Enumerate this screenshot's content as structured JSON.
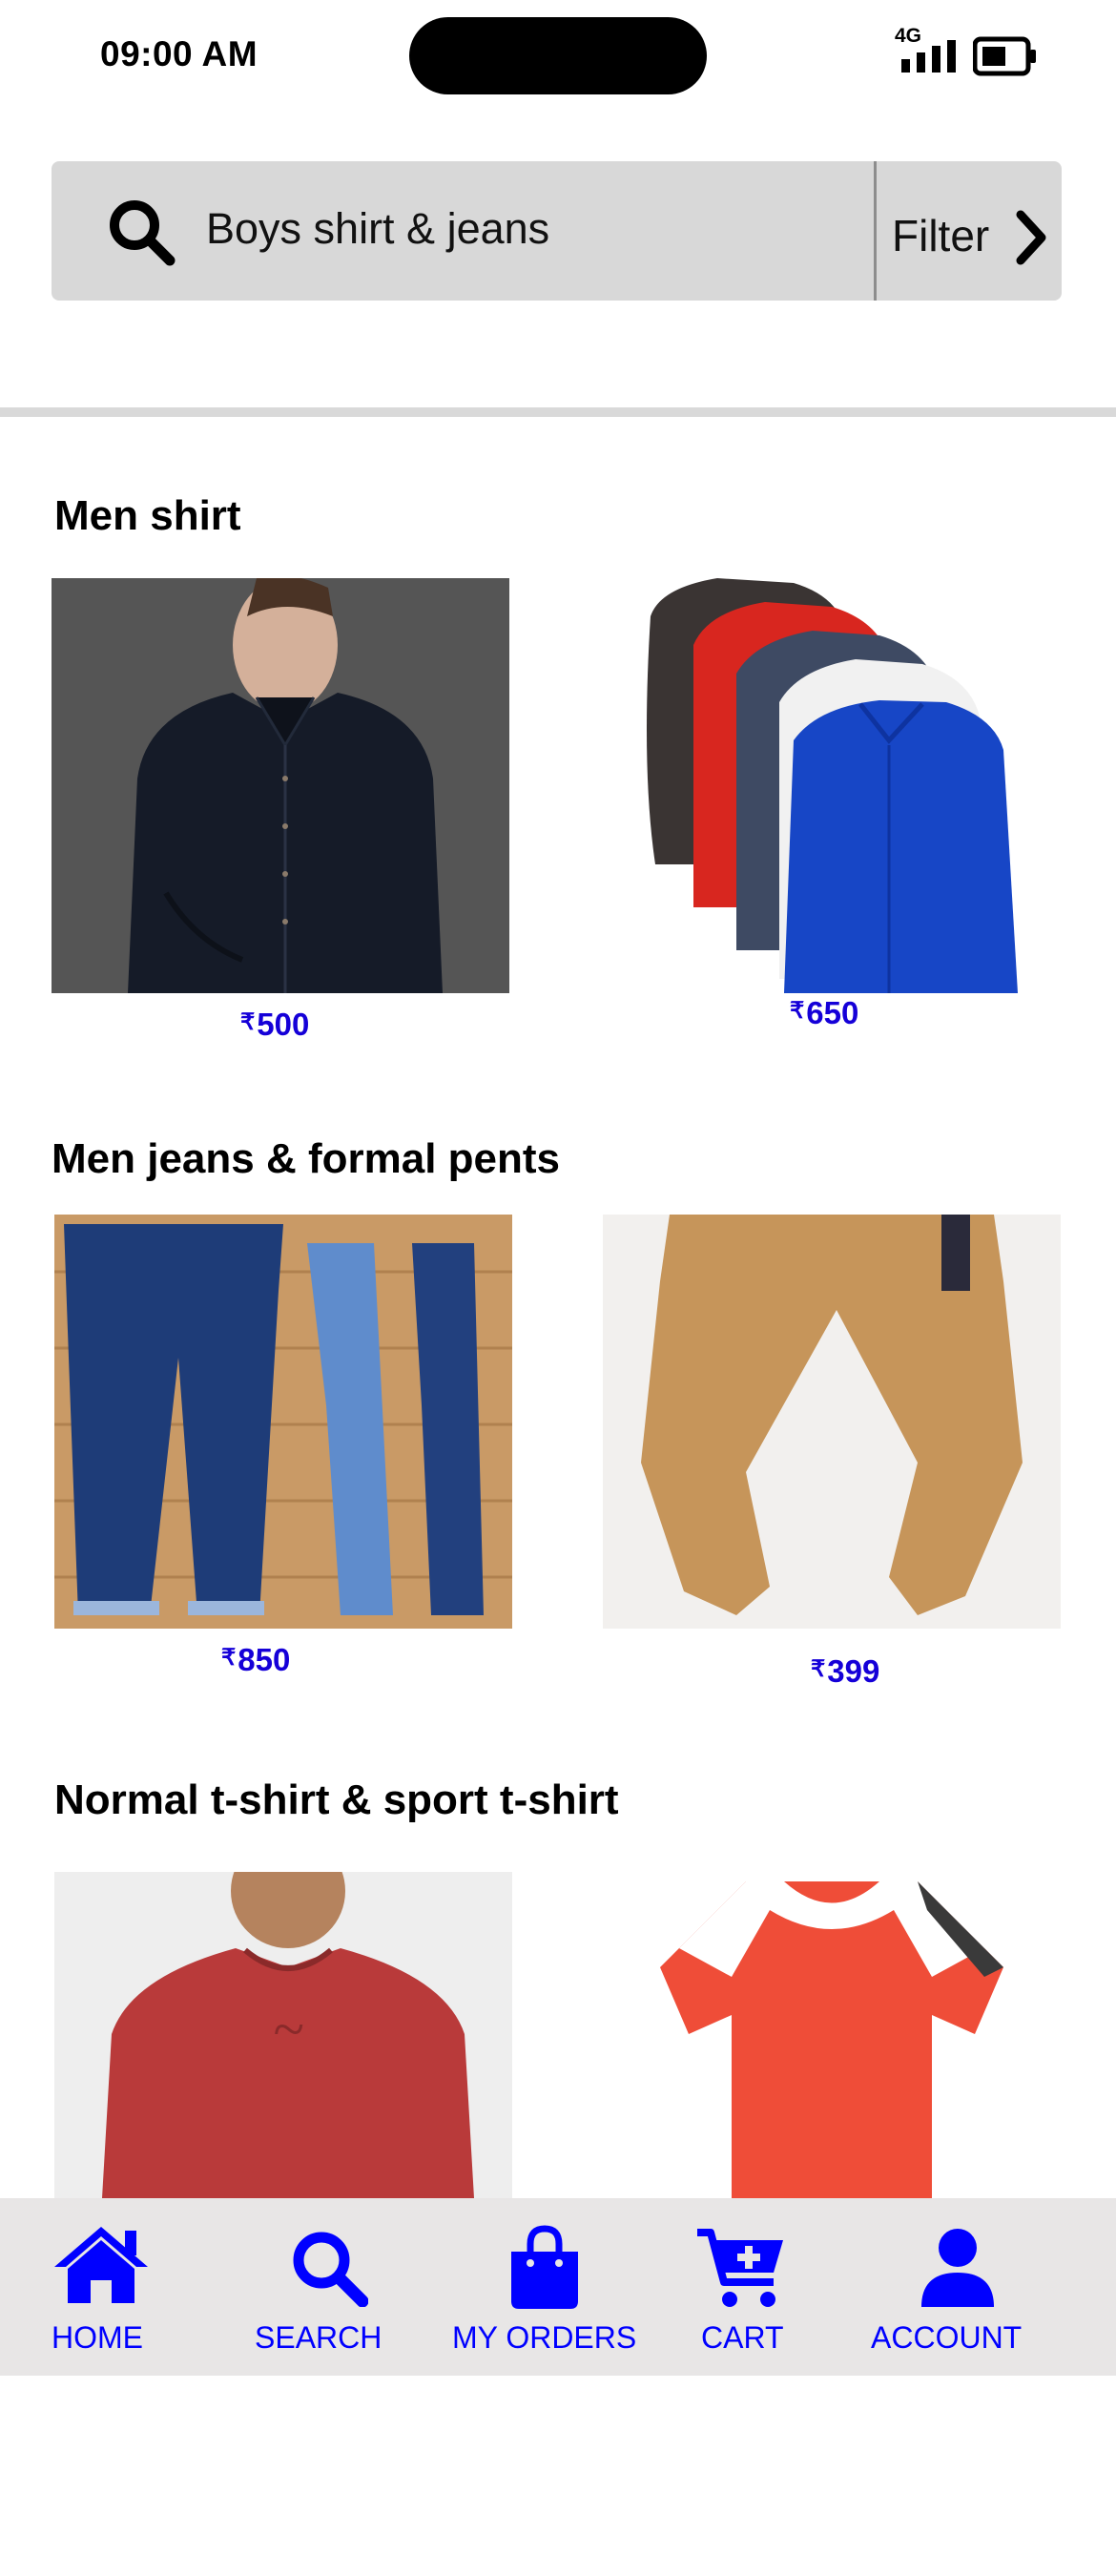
{
  "status_bar": {
    "time": "09:00 AM",
    "network": "4G"
  },
  "search": {
    "query": "Boys shirt & jeans",
    "filter_label": "Filter"
  },
  "sections": [
    {
      "title": "Men shirt",
      "products": [
        {
          "price": "500",
          "image": "dark-checked-shirt-on-model"
        },
        {
          "price": "650",
          "image": "stack-of-formal-shirts"
        }
      ]
    },
    {
      "title": "Men jeans & formal pents",
      "products": [
        {
          "price": "850",
          "image": "blue-denim-jeans"
        },
        {
          "price": "399",
          "image": "khaki-formal-pants"
        }
      ]
    },
    {
      "title": "Normal t-shirt & sport t-shirt",
      "products": [
        {
          "price": "",
          "image": "red-printed-tshirt-on-model"
        },
        {
          "price": "",
          "image": "orange-sport-tshirt"
        }
      ]
    }
  ],
  "currency_symbol": "₹",
  "nav": [
    {
      "label": "HOME",
      "icon": "home-icon"
    },
    {
      "label": "SEARCH",
      "icon": "search-icon"
    },
    {
      "label": "MY ORDERS",
      "icon": "shopping-bag-icon"
    },
    {
      "label": "CART",
      "icon": "cart-plus-icon"
    },
    {
      "label": "ACCOUNT",
      "icon": "user-icon"
    }
  ],
  "colors": {
    "accent": "#0000ff",
    "price": "#1500d8",
    "nav_bg": "#e8e6e6",
    "search_bg": "#d8d8d8"
  }
}
